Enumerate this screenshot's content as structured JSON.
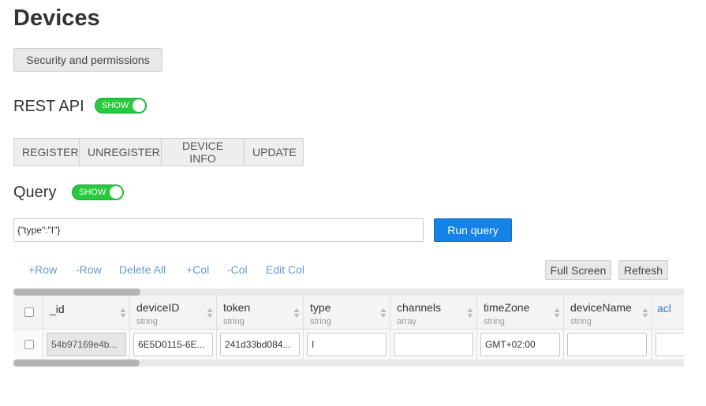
{
  "page": {
    "title": "Devices"
  },
  "security_button": "Security and permissions",
  "rest_api": {
    "title": "REST API",
    "toggle": "SHOW",
    "buttons": [
      "REGISTER",
      "UNREGISTER",
      "DEVICE INFO",
      "UPDATE"
    ]
  },
  "query": {
    "title": "Query",
    "toggle": "SHOW",
    "value": "{\"type\":\"I\"}",
    "run_label": "Run query"
  },
  "toolbar": {
    "links": [
      "+Row",
      "-Row",
      "Delete All",
      "+Col",
      "-Col",
      "Edit Col"
    ],
    "full_screen": "Full Screen",
    "refresh": "Refresh"
  },
  "table": {
    "columns": [
      {
        "name": "_id",
        "type": ""
      },
      {
        "name": "deviceID",
        "type": "string"
      },
      {
        "name": "token",
        "type": "string"
      },
      {
        "name": "type",
        "type": "string"
      },
      {
        "name": "channels",
        "type": "array"
      },
      {
        "name": "timeZone",
        "type": "string"
      },
      {
        "name": "deviceName",
        "type": "string"
      },
      {
        "name": "acl",
        "type": ""
      }
    ],
    "rows": [
      [
        "54b97169e4b...",
        "6E5D0115-6E...",
        "241d33bd084...",
        "I",
        "",
        "GMT+02:00",
        "",
        ""
      ]
    ]
  },
  "colors": {
    "accent": "#1482e6",
    "toggle_on": "#27c93f",
    "link": "#6b99c7",
    "acl_link": "#2a7ad3"
  }
}
